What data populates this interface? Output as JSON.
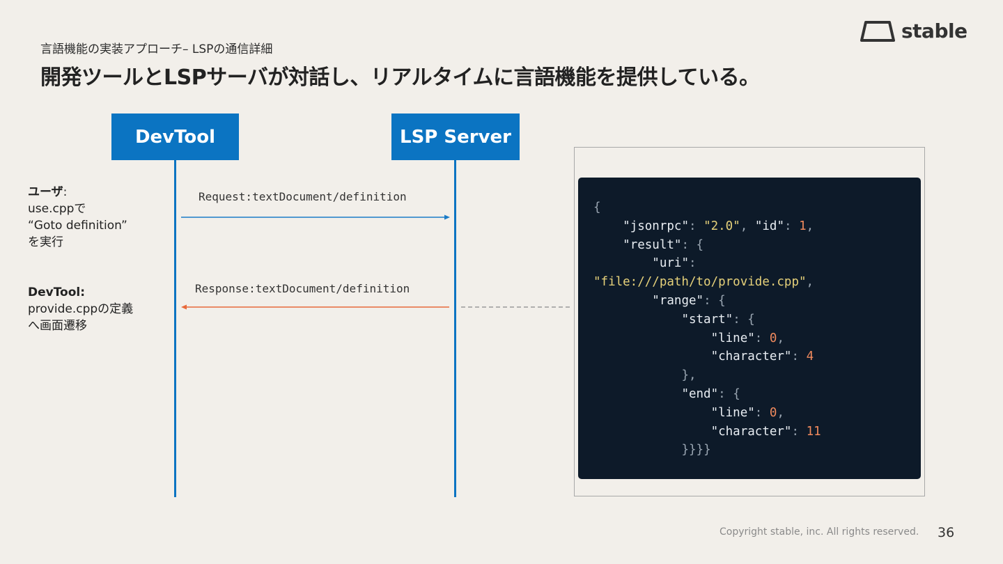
{
  "header": {
    "subtitle": "言語機能の実装アプローチ– LSPの通信詳細",
    "title": "開発ツールとLSPサーバが対話し、リアルタイムに言語機能を提供している。"
  },
  "logo": {
    "text": "stable",
    "icon": "stable-logo-icon"
  },
  "actors": [
    {
      "label": "DevTool"
    },
    {
      "label": "LSP Server"
    }
  ],
  "messages": [
    {
      "label": "Request:textDocument/definition",
      "direction": "DevTool→LSP Server",
      "color": "#1a7bc7"
    },
    {
      "label": "Response:textDocument/definition",
      "direction": "LSP Server→DevTool",
      "color": "#e8693a"
    }
  ],
  "notes": [
    {
      "heading": "ユーザ",
      "suffix": ":",
      "lines": [
        "use.cppで",
        "“Goto definition”",
        "を実行"
      ]
    },
    {
      "heading": "DevTool:",
      "suffix": "",
      "lines": [
        "provide.cppの定義",
        "へ画面遷移"
      ]
    }
  ],
  "code": {
    "lines": [
      "{",
      "    \"jsonrpc\": \"2.0\", \"id\": 1,",
      "    \"result\": {",
      "        \"uri\":",
      "\"file:///path/to/provide.cpp\",",
      "        \"range\": {",
      "            \"start\": {",
      "                \"line\": 0,",
      "                \"character\": 4",
      "            },",
      "            \"end\": {",
      "                \"line\": 0,",
      "                \"character\": 11",
      "            }}}}"
    ]
  },
  "footer": {
    "copyright": "Copyright stable, inc. All rights reserved.",
    "page_number": "36"
  },
  "colors": {
    "actor_blue": "#0b74c2",
    "response_orange": "#e8693a",
    "code_bg": "#0d1a29",
    "background": "#f2efea"
  }
}
